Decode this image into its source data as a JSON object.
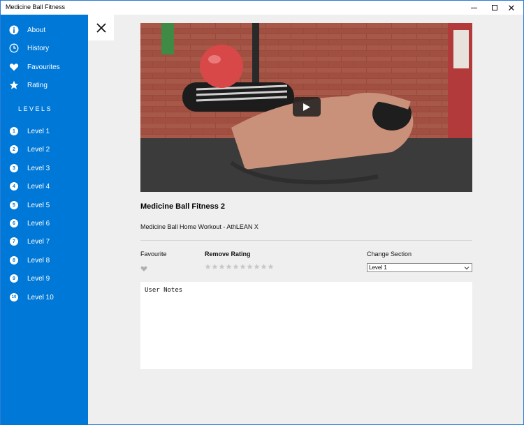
{
  "window": {
    "title": "Medicine Ball Fitness"
  },
  "sidebar": {
    "items": [
      {
        "label": "About",
        "icon": "info-icon"
      },
      {
        "label": "History",
        "icon": "clock-icon"
      },
      {
        "label": "Favourites",
        "icon": "heart-icon"
      },
      {
        "label": "Rating",
        "icon": "star-icon"
      }
    ],
    "levels_heading": "LEVELS",
    "levels": [
      {
        "num": "1",
        "label": "Level 1"
      },
      {
        "num": "2",
        "label": "Level 2"
      },
      {
        "num": "3",
        "label": "Level 3"
      },
      {
        "num": "4",
        "label": "Level 4"
      },
      {
        "num": "5",
        "label": "Level 5"
      },
      {
        "num": "6",
        "label": "Level 6"
      },
      {
        "num": "7",
        "label": "Level 7"
      },
      {
        "num": "8",
        "label": "Level 8"
      },
      {
        "num": "9",
        "label": "Level 9"
      },
      {
        "num": "10",
        "label": "Level 10"
      }
    ]
  },
  "video": {
    "title": "Medicine Ball Fitness 2",
    "subtitle": "Medicine Ball Home Workout - AthLEAN X"
  },
  "controls": {
    "favourite_label": "Favourite",
    "rating_label": "Remove Rating",
    "rating_max": 10,
    "rating_value": 0,
    "section_label": "Change Section",
    "section_value": "Level 1"
  },
  "notes": {
    "value": "User Notes"
  },
  "colors": {
    "accent": "#0078d7",
    "background": "#efefef",
    "inactive_star": "#c8c8c8"
  }
}
